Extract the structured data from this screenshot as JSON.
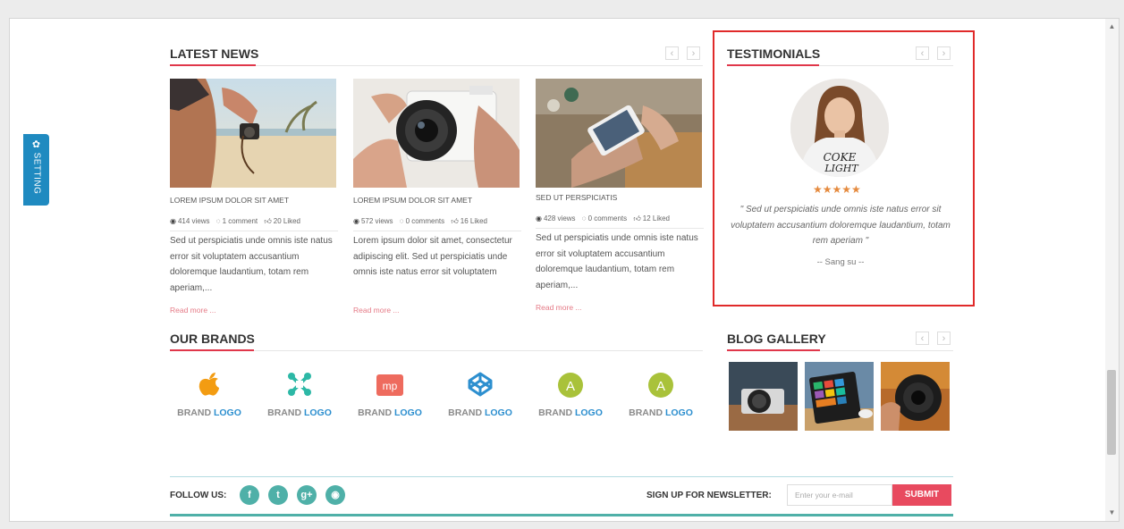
{
  "setting_tab": {
    "label": "SETTING",
    "icon": "gear-icon"
  },
  "latest_news": {
    "title": "LATEST NEWS",
    "prev_icon": "‹",
    "next_icon": "›",
    "items": [
      {
        "image": "beach-camera-photo",
        "title": "LOREM IPSUM DOLOR SIT AMET",
        "views": "414 views",
        "comments": "1 comment",
        "likes": "20 Liked",
        "body": "Sed ut perspiciatis unde omnis iste natus error sit voluptatem accusantium doloremque laudantium, totam rem aperiam,...",
        "read_more": "Read more ..."
      },
      {
        "image": "hand-holding-camera-photo",
        "title": "LOREM IPSUM DOLOR SIT AMET",
        "views": "572 views",
        "comments": "0 comments",
        "likes": "16 Liked",
        "body": "Lorem ipsum dolor sit amet, consectetur adipiscing elit. Sed ut perspiciatis unde omnis iste natus error sit voluptatem",
        "read_more": "Read more ..."
      },
      {
        "image": "smartphone-photo",
        "title": "SED UT PERSPICIATIS",
        "views": "428 views",
        "comments": "0 comments",
        "likes": "12 Liked",
        "body": "Sed ut perspiciatis unde omnis iste natus error sit voluptatem accusantium doloremque laudantium, totam rem aperiam,...",
        "read_more": "Read more ..."
      }
    ]
  },
  "testimonials": {
    "title": "TESTIMONIALS",
    "rating": 5,
    "stars": "★★★★★",
    "quote": "\" Sed ut perspiciatis unde omnis iste natus error sit voluptatem accusantium doloremque laudantium, totam rem aperiam \"",
    "author": "-- Sang su --",
    "highlight_color": "#e02a2a"
  },
  "our_brands": {
    "title": "OUR BRANDS",
    "items": [
      {
        "icon": "apple-icon",
        "word1": "BRAND",
        "word2": "LOGO",
        "color": "#f39c12"
      },
      {
        "icon": "joomla-icon",
        "word1": "BRAND",
        "word2": "LOGO",
        "color": "#2db8a6"
      },
      {
        "icon": "mp-icon",
        "word1": "BRAND",
        "word2": "LOGO",
        "color": "#ee6b5e",
        "mark": "mp"
      },
      {
        "icon": "codepen-icon",
        "word1": "BRAND",
        "word2": "LOGO",
        "color": "#2d8fcf"
      },
      {
        "icon": "a-circle-icon",
        "word1": "BRAND",
        "word2": "LOGO",
        "color": "#a9c23a",
        "mark": "A"
      },
      {
        "icon": "a-circle-icon",
        "word1": "BRAND",
        "word2": "LOGO",
        "color": "#a9c23a",
        "mark": "A"
      }
    ]
  },
  "blog_gallery": {
    "title": "BLOG GALLERY",
    "images": [
      "camera-on-table-photo",
      "tablet-photo",
      "camera-lens-photo"
    ]
  },
  "footer": {
    "follow_label": "FOLLOW US:",
    "social": [
      {
        "icon": "facebook-icon",
        "glyph": "f"
      },
      {
        "icon": "twitter-icon",
        "glyph": "t"
      },
      {
        "icon": "google-plus-icon",
        "glyph": "g+"
      },
      {
        "icon": "rss-icon",
        "glyph": "◉"
      }
    ],
    "newsletter_label": "SIGN UP FOR NEWSLETTER:",
    "email_placeholder": "Enter your e-mail",
    "submit_label": "SUBMIT"
  },
  "colors": {
    "accent": "#e0374a",
    "teal": "#4fb0a8",
    "setting_blue": "#1f8ac0"
  }
}
